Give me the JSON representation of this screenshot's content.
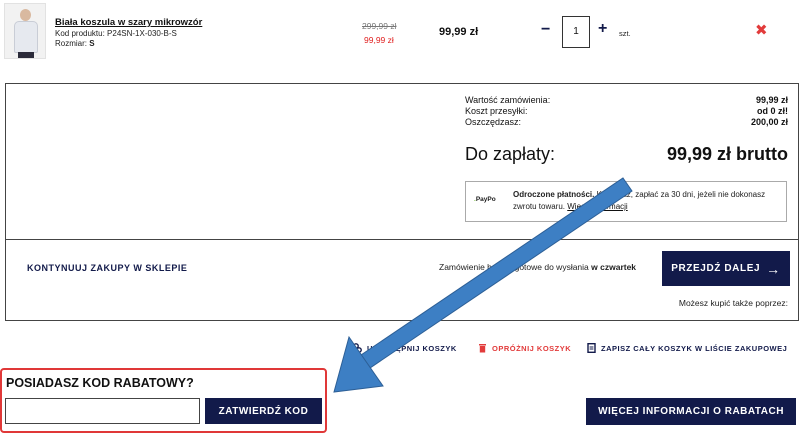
{
  "product": {
    "name": "Biała koszula w szary mikrowzór",
    "code_label": "Kod produktu:",
    "code_value": "P24SN-1X-030-B-S",
    "size_label": "Rozmiar:",
    "size_value": "S",
    "old_price": "299,99 zł",
    "new_price": "99,99 zł",
    "unit_price": "99,99 zł",
    "quantity": "1",
    "qty_unit": "szt.",
    "minus_glyph": "−",
    "plus_glyph": "+",
    "remove_glyph": "✖"
  },
  "summary": {
    "order_value_label": "Wartość zamówienia:",
    "order_value": "99,99 zł",
    "shipping_label": "Koszt przesyłki:",
    "shipping_value": "od 0 zł!",
    "savings_label": "Oszczędzasz:",
    "savings_value": "200,00 zł",
    "to_pay_label": "Do zapłaty:",
    "to_pay_value": "99,99 zł brutto"
  },
  "paypo": {
    "logo_text": "PayPo",
    "bold_text": "Odroczone płatności.",
    "text": " Kup teraz, zapłać za 30 dni, jeżeli nie dokonasz zwrotu towaru. ",
    "link": "Więcej informacji"
  },
  "actions": {
    "continue_shopping": "KONTYNUUJ ZAKUPY W SKLEPIE",
    "shipping_prefix": "Zamówienie będzie gotowe do wysłania ",
    "shipping_day": "w czwartek",
    "next_button": "PRZEJDŹ DALEJ",
    "buy_also": "Możesz kupić także poprzez:",
    "share_cart": "UDOSTĘPNIJ KOSZYK",
    "clear_cart": "OPRÓŻNIJ KOSZYK",
    "save_cart": "ZAPISZ CAŁY KOSZYK W LIŚCIE ZAKUPOWEJ"
  },
  "discount": {
    "title": "POSIADASZ KOD RABATOWY?",
    "input_value": "",
    "apply_button": "ZATWIERDŹ KOD",
    "more_info_button": "WIĘCEJ INFORMACJI O RABATACH"
  },
  "colors": {
    "navy": "#121a4a",
    "red": "#e23b3b",
    "annotation_blue": "#3d7fc4"
  }
}
